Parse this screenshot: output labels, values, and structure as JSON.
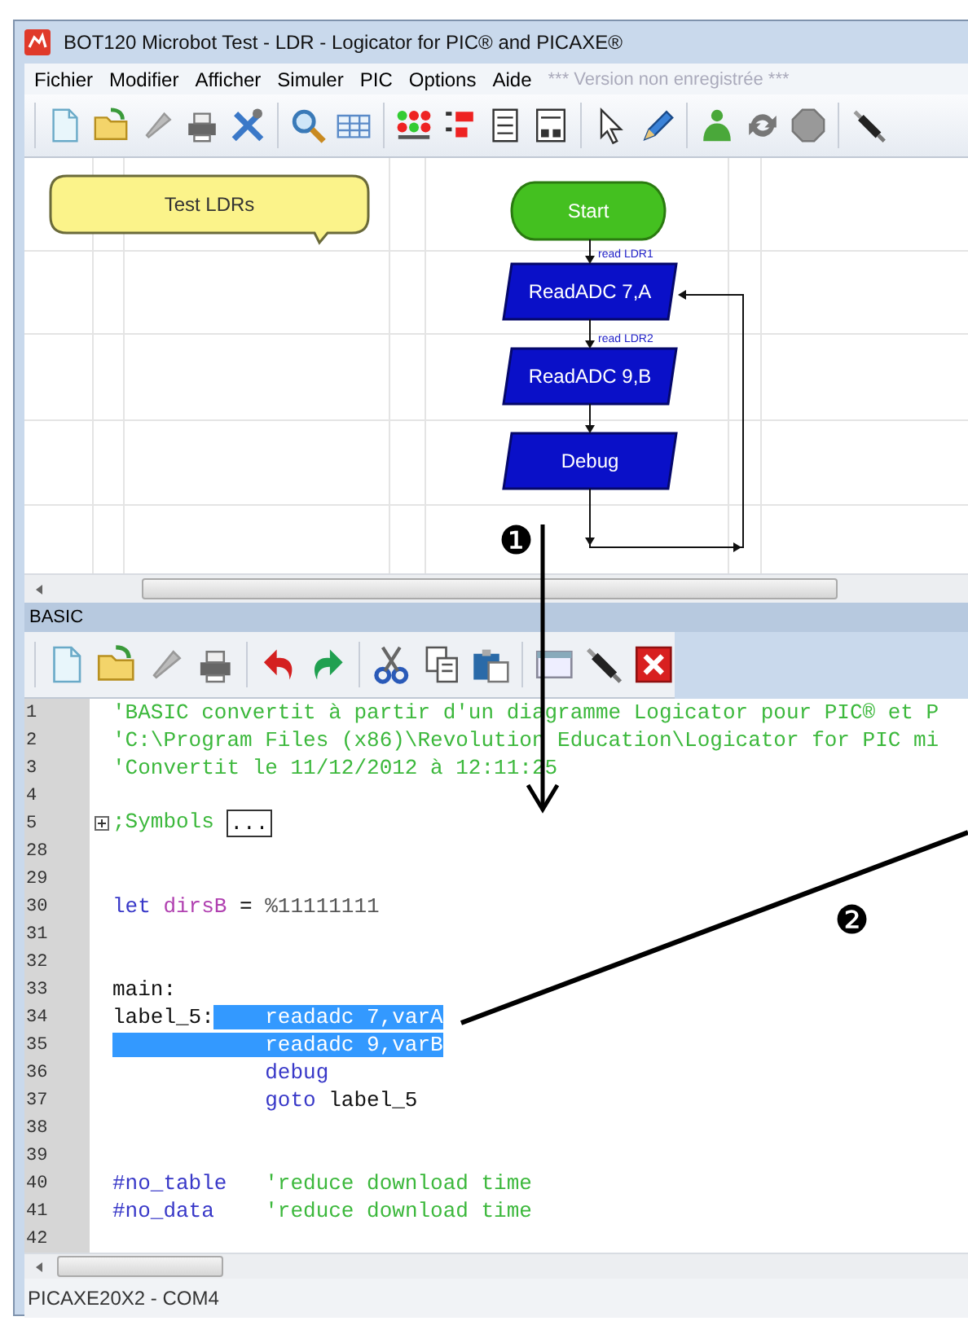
{
  "window": {
    "title": "BOT120 Microbot Test - LDR - Logicator for PIC® and PICAXE®"
  },
  "menu": {
    "items": [
      "Fichier",
      "Modifier",
      "Afficher",
      "Simuler",
      "PIC",
      "Options",
      "Aide"
    ],
    "note": "*** Version non enregistrée ***"
  },
  "flowchart": {
    "nodes": [
      {
        "kind": "comment",
        "text": "Test LDRs"
      },
      {
        "kind": "start",
        "text": "Start"
      },
      {
        "kind": "process",
        "text": "ReadADC 7,A"
      },
      {
        "kind": "process",
        "text": "ReadADC 9,B"
      },
      {
        "kind": "process",
        "text": "Debug"
      }
    ],
    "connector_labels": [
      "read LDR1",
      "read LDR2"
    ]
  },
  "basic_panel": {
    "title": "BASIC",
    "lines": [
      {
        "number": "1",
        "segments": [
          {
            "text": "'BASIC convertit à partir d'un diagramme Logicator pour PIC® et P",
            "kind": "comment",
            "selected": false
          }
        ]
      },
      {
        "number": "2",
        "segments": [
          {
            "text": "'C:\\Program Files (x86)\\Revolution Education\\Logicator for PIC mi",
            "kind": "comment",
            "selected": false
          }
        ]
      },
      {
        "number": "3",
        "segments": [
          {
            "text": "'Convertit le 11/12/2012 à 12:11:25",
            "kind": "comment",
            "selected": false
          }
        ]
      },
      {
        "number": "4"
      },
      {
        "number": "5",
        "folded": true,
        "segments": [
          {
            "text": ";Symbols ",
            "kind": "comment",
            "selected": false
          },
          {
            "text": "...",
            "kind": "ellipsis",
            "selected": false
          }
        ]
      },
      {
        "number": "28"
      },
      {
        "number": "29"
      },
      {
        "number": "30",
        "segments": [
          {
            "text": "let",
            "kind": "keyword",
            "selected": false
          },
          {
            "text": " dirsB",
            "kind": "variable",
            "selected": false
          },
          {
            "text": " = ",
            "kind": "plain",
            "selected": false
          },
          {
            "text": "%11111111",
            "kind": "number",
            "selected": false
          }
        ]
      },
      {
        "number": "31"
      },
      {
        "number": "32"
      },
      {
        "number": "33",
        "segments": [
          {
            "text": "main:",
            "kind": "plain",
            "selected": false
          }
        ]
      },
      {
        "number": "34",
        "segments": [
          {
            "text": "label_5:",
            "kind": "plain",
            "selected": false
          },
          {
            "text": "    readadc 7,varA",
            "kind": "keyword",
            "selected": true
          }
        ]
      },
      {
        "number": "35",
        "segments": [
          {
            "text": "            readadc 9,varB",
            "kind": "keyword",
            "selected": true
          }
        ]
      },
      {
        "number": "36",
        "segments": [
          {
            "text": "            debug",
            "kind": "keyword",
            "selected": false
          }
        ]
      },
      {
        "number": "37",
        "segments": [
          {
            "text": "            goto",
            "kind": "keyword",
            "selected": false
          },
          {
            "text": " label_5",
            "kind": "plain",
            "selected": false
          }
        ]
      },
      {
        "number": "38"
      },
      {
        "number": "39"
      },
      {
        "number": "40",
        "segments": [
          {
            "text": "#no_table",
            "kind": "keyword",
            "selected": false
          },
          {
            "text": "   'reduce download time",
            "kind": "comment",
            "selected": false
          }
        ]
      },
      {
        "number": "41",
        "segments": [
          {
            "text": "#no_data",
            "kind": "keyword",
            "selected": false
          },
          {
            "text": "    'reduce download time",
            "kind": "comment",
            "selected": false
          }
        ]
      },
      {
        "number": "42"
      }
    ]
  },
  "status_bar": "PICAXE20X2 - COM4",
  "annotations": [
    {
      "kind": "arrow",
      "marker": "❶"
    },
    {
      "kind": "line",
      "marker": "❷"
    }
  ]
}
